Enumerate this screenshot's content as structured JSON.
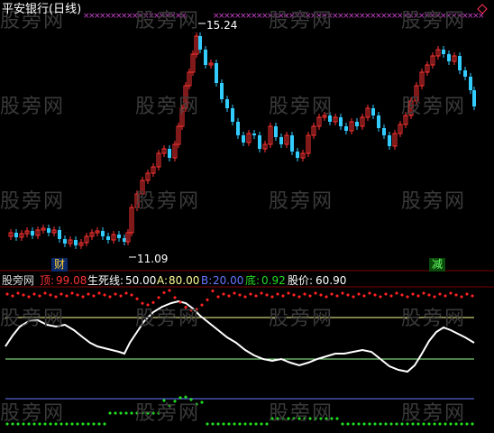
{
  "chart_title": "平安银行(日线)",
  "high_price_label": "15.24",
  "low_price_label": "11.09",
  "buy_marker": "财",
  "sell_marker": "减",
  "watermark": "股旁网",
  "indicator": {
    "name": "股旁网",
    "top_label": "顶:",
    "top_value": "99.08",
    "life_line_label": "生死线:",
    "life_line_value": "50.00",
    "a_label": "A:",
    "a_value": "80.00",
    "b_label": "B:",
    "b_value": "20.00",
    "bottom_label": "底:",
    "bottom_value": "0.92",
    "stock_price_label": "股价:",
    "stock_price_value": "60.90"
  },
  "colors": {
    "up": "#ff3333",
    "down": "#33ccff",
    "top_dots": "#ff2222",
    "bottom_dots": "#22dd22",
    "line_a": "#ffff99",
    "line_b": "#99ff99",
    "line_blue": "#6677ff",
    "price_line": "#ffffff",
    "cross_marks": "#cc44cc"
  },
  "chart_data": {
    "type": "candlestick",
    "title": "平安银行(日线)",
    "annotations": [
      "15.24",
      "11.09"
    ],
    "indicator_levels": {
      "A": 80,
      "life_line": 50,
      "B": 20
    }
  }
}
